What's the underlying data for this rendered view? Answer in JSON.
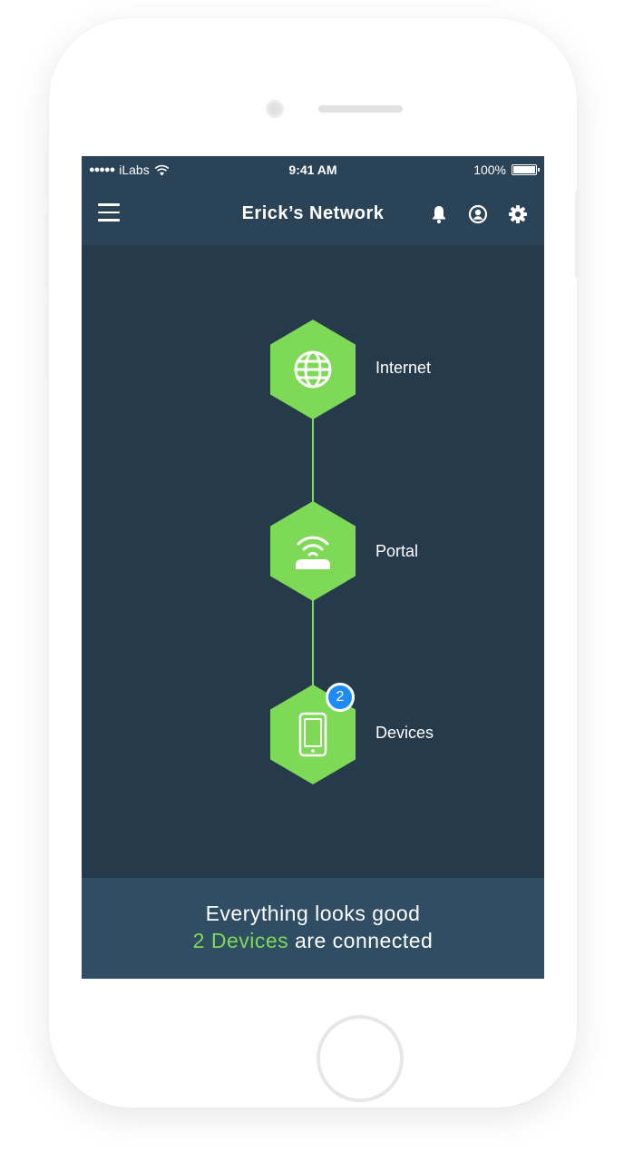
{
  "status_bar": {
    "signal": "●●●●●",
    "carrier": "iLabs",
    "time": "9:41 AM",
    "battery_percent": "100%",
    "battery_level": 1.0
  },
  "nav": {
    "title": "Erick’s Network",
    "icons": [
      "menu-icon",
      "bell-icon",
      "user-circle-icon",
      "gear-icon"
    ]
  },
  "topology": {
    "nodes": [
      {
        "label": "Internet",
        "icon": "globe-icon"
      },
      {
        "label": "Portal",
        "icon": "router-icon"
      },
      {
        "label": "Devices",
        "icon": "phone-icon",
        "badge": "2"
      }
    ]
  },
  "footer": {
    "line1": "Everything looks good",
    "devices_link": "2 Devices",
    "line2_suffix": " are connected"
  },
  "colors": {
    "accent_green": "#7ed957",
    "background": "#253a4b",
    "nav_bar": "#2b4357",
    "footer": "#2f4d63",
    "badge": "#1d8cf8"
  }
}
